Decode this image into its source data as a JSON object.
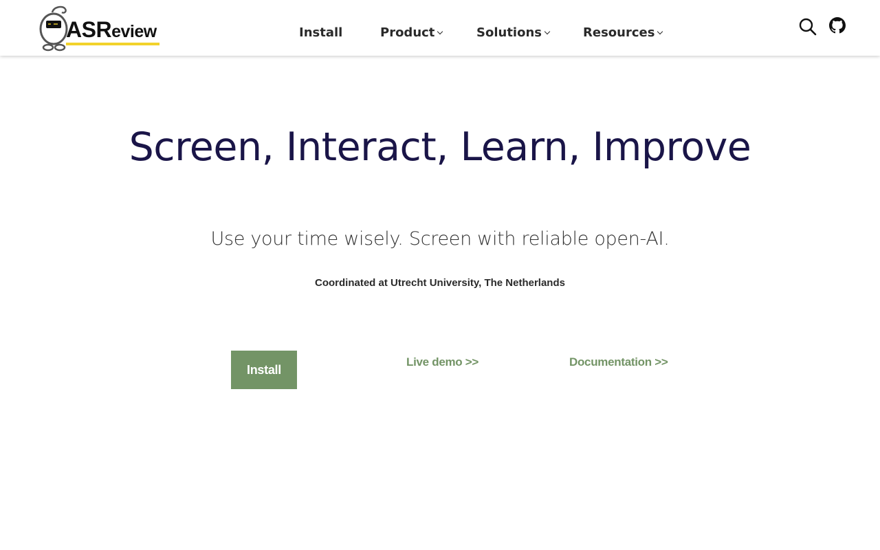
{
  "header": {
    "logo": {
      "text_strong": "ASR",
      "text_light": "eview",
      "underline_color": "#f2d22b"
    },
    "nav": [
      {
        "label": "Install",
        "has_dropdown": false
      },
      {
        "label": "Product",
        "has_dropdown": true
      },
      {
        "label": "Solutions",
        "has_dropdown": true
      },
      {
        "label": "Resources",
        "has_dropdown": true
      }
    ],
    "icons": {
      "search": "search-icon",
      "github": "github-icon"
    }
  },
  "hero": {
    "title": "Screen, Interact, Learn, Improve",
    "subtitle": "Use your time wisely. Screen with reliable open-AI.",
    "coordination": "Coordinated at Utrecht University, The Netherlands"
  },
  "cta": {
    "install_label": "Install",
    "live_demo_label": "Live demo >>",
    "documentation_label": "Documentation >>"
  },
  "colors": {
    "title": "#1a1548",
    "accent_green": "#739466",
    "logo_yellow": "#f2d22b"
  }
}
